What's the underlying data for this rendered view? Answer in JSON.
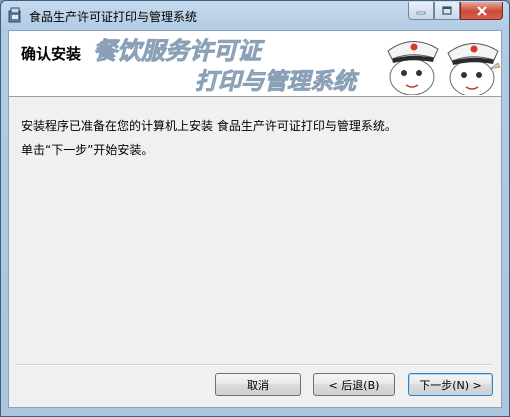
{
  "window": {
    "title": "食品生产许可证打印与管理系统",
    "minimize_icon": "minimize-icon",
    "maximize_icon": "maximize-icon",
    "close_icon": "close-icon"
  },
  "banner": {
    "heading": "确认安装",
    "calligraphy_line1": "餐饮服务许可证",
    "calligraphy_line2": "打印与管理系统",
    "logo": "officer-cartoon"
  },
  "content": {
    "message": "安装程序已准备在您的计算机上安装 食品生产许可证打印与管理系统。",
    "instruction": "单击“下一步”开始安装。"
  },
  "buttons": {
    "cancel": "取消",
    "back": "< 后退(B)",
    "next": "下一步(N) >"
  },
  "colors": {
    "title_gradient_top": "#c6daee",
    "client_bg": "#f0f0f0",
    "close_red": "#c94a36",
    "default_button_border": "#3c7fb1"
  }
}
